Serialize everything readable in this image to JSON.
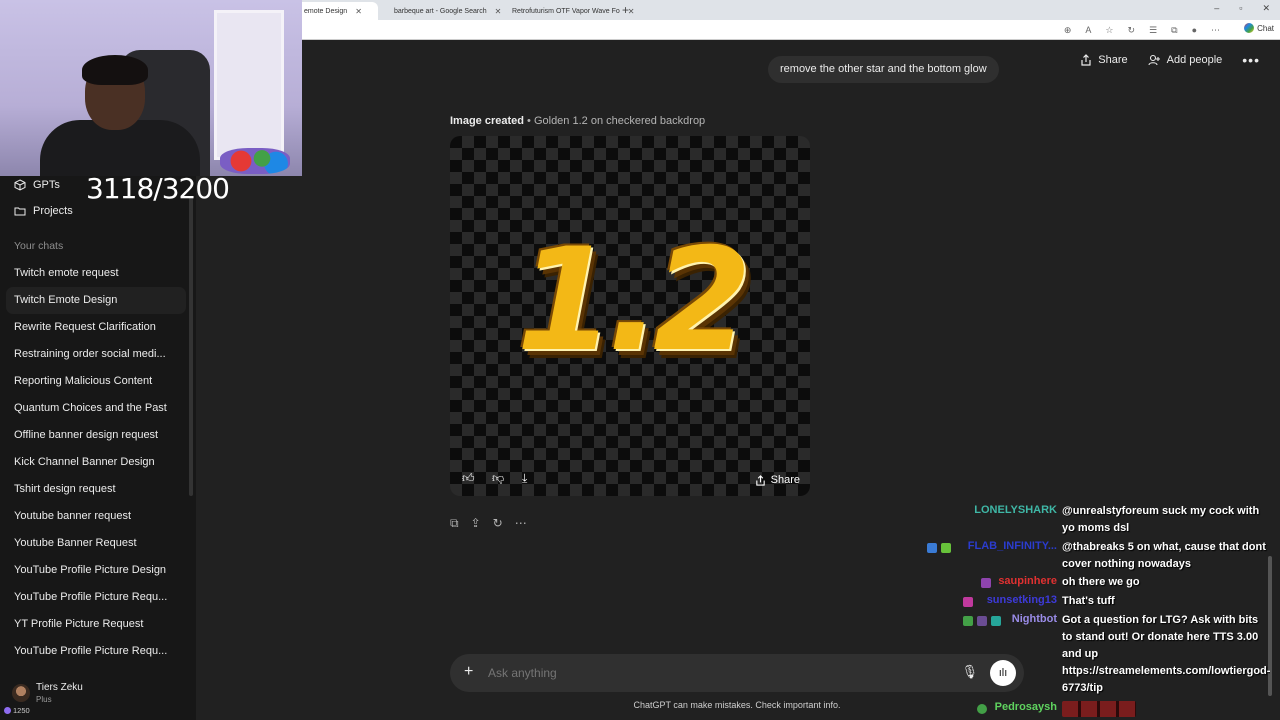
{
  "browser": {
    "tabs": [
      {
        "label": "emote Design",
        "active": true
      },
      {
        "label": "barbeque art - Google Search",
        "active": false
      },
      {
        "label": "Retrofuturism OTF Vapor Wave Fo",
        "active": false
      }
    ],
    "new_tab": "+",
    "window_controls": [
      "–",
      "▫",
      "✕"
    ]
  },
  "stream": {
    "counter": "3118/3200"
  },
  "sidebar": {
    "gpts_label": "GPTs",
    "projects_label": "Projects",
    "section_label": "Your chats",
    "chats": [
      {
        "label": "Twitch emote request"
      },
      {
        "label": "Twitch Emote Design",
        "active": true
      },
      {
        "label": "Rewrite Request Clarification"
      },
      {
        "label": "Restraining order social medi..."
      },
      {
        "label": "Reporting Malicious Content"
      },
      {
        "label": "Quantum Choices and the Past"
      },
      {
        "label": "Offline banner design request"
      },
      {
        "label": "Kick Channel Banner Design"
      },
      {
        "label": "Tshirt design request"
      },
      {
        "label": "Youtube banner request"
      },
      {
        "label": "Youtube Banner Request"
      },
      {
        "label": "YouTube Profile Picture Design"
      },
      {
        "label": "YouTube Profile Picture Requ..."
      },
      {
        "label": "YT Profile Picture Request"
      },
      {
        "label": "YouTube Profile Picture Requ..."
      }
    ],
    "user": {
      "name": "Tiers Zeku",
      "plan": "Plus"
    },
    "points": "1250"
  },
  "header": {
    "share_label": "Share",
    "add_people_label": "Add people",
    "more_label": "•••"
  },
  "conversation": {
    "user_message": "remove the other star and the bottom glow",
    "image_caption_strong": "Image created",
    "image_caption_sub": " • Golden 1.2 on checkered backdrop",
    "emote_text": "1.2",
    "image_share_label": "Share"
  },
  "composer": {
    "placeholder": "Ask anything",
    "disclaimer": "ChatGPT can make mistakes. Check important info."
  },
  "twitch_chat": [
    {
      "name": "LONELYSHARK",
      "name_color": "#3fb7a6",
      "message": "@unrealstyforeum suck my cock with yo moms dsl"
    },
    {
      "name": "FLAB_INFINITY...",
      "name_color": "#2b3ccf",
      "message": "@thabreaks 5 on what, cause that dont cover nothing nowadays"
    },
    {
      "name": "saupinhere",
      "name_color": "#e03131",
      "message": "oh there we go"
    },
    {
      "name": "sunsetking13",
      "name_color": "#3d3ad8",
      "message": "That's tuff"
    },
    {
      "name": "Nightbot",
      "name_color": "#9a8ce8",
      "message": "Got a question for LTG? Ask with bits to stand out! Or donate here TTS 3.00 and up https://streamelements.com/lowtiergod-6773/tip"
    },
    {
      "name": "Pedrosaysh",
      "name_color": "#5fd35f",
      "message": ""
    }
  ]
}
